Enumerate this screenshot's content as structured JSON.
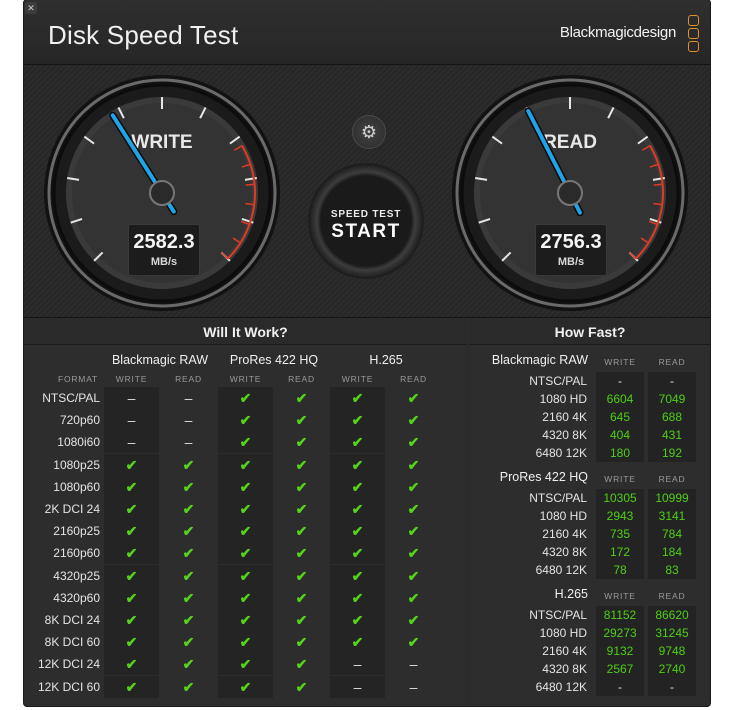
{
  "app": {
    "title": "Disk Speed Test",
    "brand": "Blackmagicdesign",
    "close_glyph": "✕"
  },
  "colors": {
    "ok_green": "#56d21c",
    "needle_blue": "#1fa4e8",
    "redline": "#e03a25",
    "brand_orange": "#e0912b"
  },
  "gauges": {
    "write": {
      "label": "WRITE",
      "value": "2582.3",
      "unit": "MB/s",
      "level": 0.38
    },
    "read": {
      "label": "READ",
      "value": "2756.3",
      "unit": "MB/s",
      "level": 0.4
    },
    "settings_icon": "gear-icon",
    "start_small": "SPEED TEST",
    "start_big": "START"
  },
  "will_it_work": {
    "title": "Will It Work?",
    "format_header": "FORMAT",
    "groups": [
      "Blackmagic RAW",
      "ProRes 422 HQ",
      "H.265"
    ],
    "subheaders": [
      "WRITE",
      "READ",
      "WRITE",
      "READ",
      "WRITE",
      "READ"
    ],
    "ok_glyph": "✔",
    "no_glyph": "–",
    "rows": [
      {
        "format": "NTSC/PAL",
        "cells": [
          0,
          0,
          1,
          1,
          1,
          1
        ]
      },
      {
        "format": "720p60",
        "cells": [
          0,
          0,
          1,
          1,
          1,
          1
        ]
      },
      {
        "format": "1080i60",
        "cells": [
          0,
          0,
          1,
          1,
          1,
          1
        ]
      },
      {
        "format": "1080p25",
        "cells": [
          1,
          1,
          1,
          1,
          1,
          1
        ]
      },
      {
        "format": "1080p60",
        "cells": [
          1,
          1,
          1,
          1,
          1,
          1
        ]
      },
      {
        "format": "2K DCI 24",
        "cells": [
          1,
          1,
          1,
          1,
          1,
          1
        ]
      },
      {
        "format": "2160p25",
        "cells": [
          1,
          1,
          1,
          1,
          1,
          1
        ]
      },
      {
        "format": "2160p60",
        "cells": [
          1,
          1,
          1,
          1,
          1,
          1
        ]
      },
      {
        "format": "4320p25",
        "cells": [
          1,
          1,
          1,
          1,
          1,
          1
        ]
      },
      {
        "format": "4320p60",
        "cells": [
          1,
          1,
          1,
          1,
          1,
          1
        ]
      },
      {
        "format": "8K DCI 24",
        "cells": [
          1,
          1,
          1,
          1,
          1,
          1
        ]
      },
      {
        "format": "8K DCI 60",
        "cells": [
          1,
          1,
          1,
          1,
          1,
          1
        ]
      },
      {
        "format": "12K DCI 24",
        "cells": [
          1,
          1,
          1,
          1,
          0,
          0
        ]
      },
      {
        "format": "12K DCI 60",
        "cells": [
          1,
          1,
          1,
          1,
          0,
          0
        ]
      }
    ]
  },
  "how_fast": {
    "title": "How Fast?",
    "write_label": "WRITE",
    "read_label": "READ",
    "groups": [
      {
        "name": "Blackmagic RAW",
        "rows": [
          {
            "format": "NTSC/PAL",
            "write": "-",
            "read": "-"
          },
          {
            "format": "1080 HD",
            "write": "6604",
            "read": "7049"
          },
          {
            "format": "2160 4K",
            "write": "645",
            "read": "688"
          },
          {
            "format": "4320 8K",
            "write": "404",
            "read": "431"
          },
          {
            "format": "6480 12K",
            "write": "180",
            "read": "192"
          }
        ]
      },
      {
        "name": "ProRes 422 HQ",
        "rows": [
          {
            "format": "NTSC/PAL",
            "write": "10305",
            "read": "10999"
          },
          {
            "format": "1080 HD",
            "write": "2943",
            "read": "3141"
          },
          {
            "format": "2160 4K",
            "write": "735",
            "read": "784"
          },
          {
            "format": "4320 8K",
            "write": "172",
            "read": "184"
          },
          {
            "format": "6480 12K",
            "write": "78",
            "read": "83"
          }
        ]
      },
      {
        "name": "H.265",
        "rows": [
          {
            "format": "NTSC/PAL",
            "write": "81152",
            "read": "86620"
          },
          {
            "format": "1080 HD",
            "write": "29273",
            "read": "31245"
          },
          {
            "format": "2160 4K",
            "write": "9132",
            "read": "9748"
          },
          {
            "format": "4320 8K",
            "write": "2567",
            "read": "2740"
          },
          {
            "format": "6480 12K",
            "write": "-",
            "read": "-"
          }
        ]
      }
    ]
  }
}
